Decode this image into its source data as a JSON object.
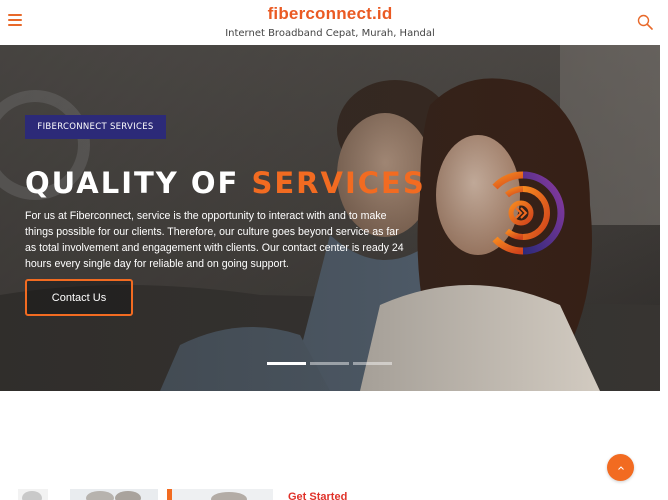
{
  "header": {
    "brand_name": "fiberconnect.id",
    "tagline": "Internet Broadband Cepat, Murah, Handal",
    "menu_icon": "hamburger-menu-icon",
    "search_icon": "search-icon"
  },
  "hero": {
    "badge": "FIBERCONNECT SERVICES",
    "title_part1": "QUALITY OF ",
    "title_accent": "SERVICES",
    "description": "For us at Fiberconnect, service is the opportunity to interact with and to make things possible for our clients. Therefore, our culture goes beyond service as far as total involvement and engagement with clients. Our contact center is ready 24 hours every single day for reliable and on going support.",
    "cta_label": "Contact Us",
    "logo_icon": "fiberconnect-signal-logo-icon",
    "slides": [
      "slide-1",
      "slide-2",
      "slide-3"
    ],
    "active_slide": 0
  },
  "below": {
    "section_title": "Get Started"
  },
  "scroll_top_icon": "chevron-up-icon",
  "colors": {
    "brand_orange": "#f26b21",
    "badge_navy": "#2c2a78",
    "heading_red": "#e0322a"
  }
}
